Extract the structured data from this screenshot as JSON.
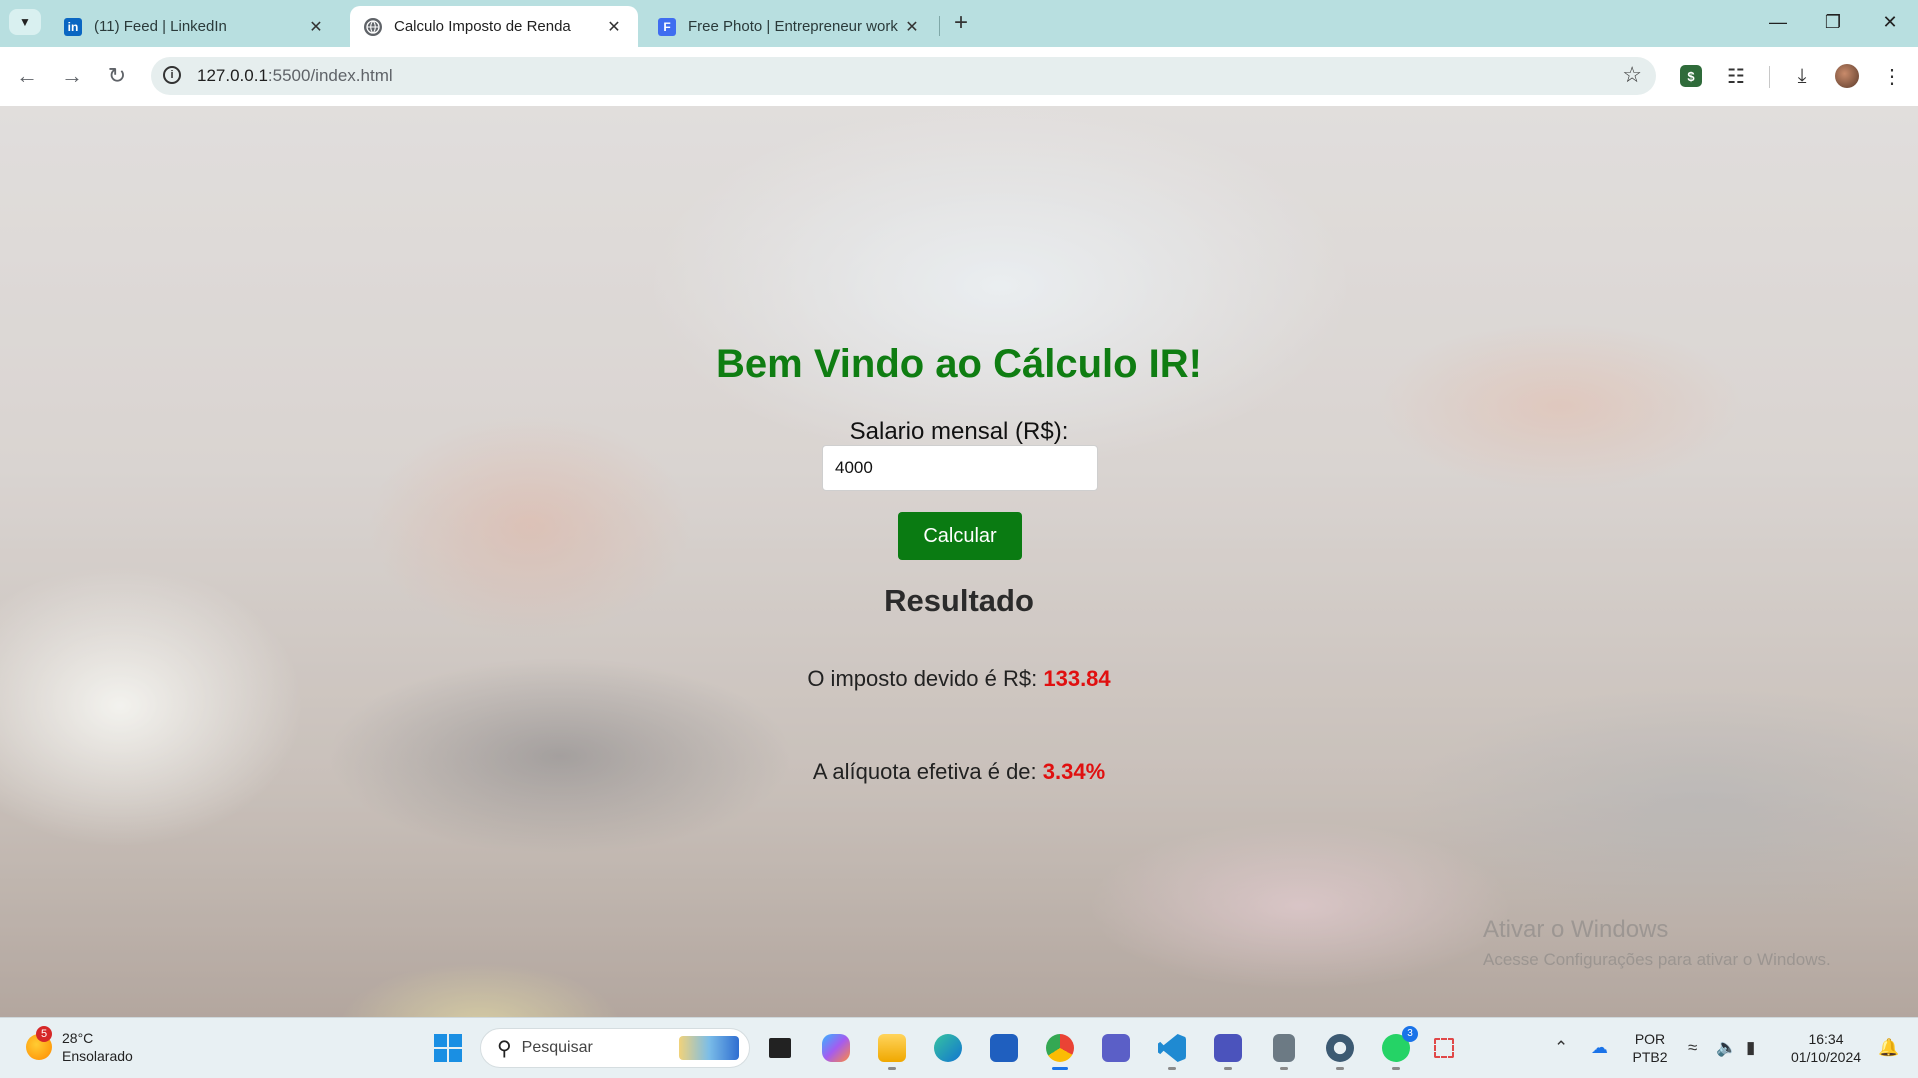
{
  "browser": {
    "tabs": [
      {
        "title": "(11) Feed | LinkedIn",
        "favicon": "linkedin-icon",
        "active": false
      },
      {
        "title": "Calculo Imposto de Renda",
        "favicon": "globe-icon",
        "active": true
      },
      {
        "title": "Free Photo | Entrepreneur work",
        "favicon": "freepik-icon",
        "active": false
      }
    ],
    "url_host": "127.0.0.1",
    "url_rest": ":5500/index.html"
  },
  "app": {
    "heading": "Bem Vindo ao Cálculo IR!",
    "salary_label": "Salario mensal (R$):",
    "salary_value": "4000",
    "calc_button": "Calcular",
    "result_title": "Resultado",
    "tax_prefix": "O imposto devido é R$:",
    "tax_value": "133.84",
    "rate_prefix": "A alíquota efetiva é de:",
    "rate_value": "3.34%",
    "colors": {
      "heading": "#0f7d12",
      "button": "#0a7b12",
      "highlight": "#e01010"
    }
  },
  "watermark": {
    "line1": "Ativar o Windows",
    "line2": "Acesse Configurações para ativar o Windows."
  },
  "taskbar": {
    "weather_temp": "28°C",
    "weather_desc": "Ensolarado",
    "weather_badge": "5",
    "search_placeholder": "Pesquisar",
    "lang_1": "POR",
    "lang_2": "PTB2",
    "time": "16:34",
    "date": "01/10/2024",
    "whatsapp_badge": "3"
  }
}
